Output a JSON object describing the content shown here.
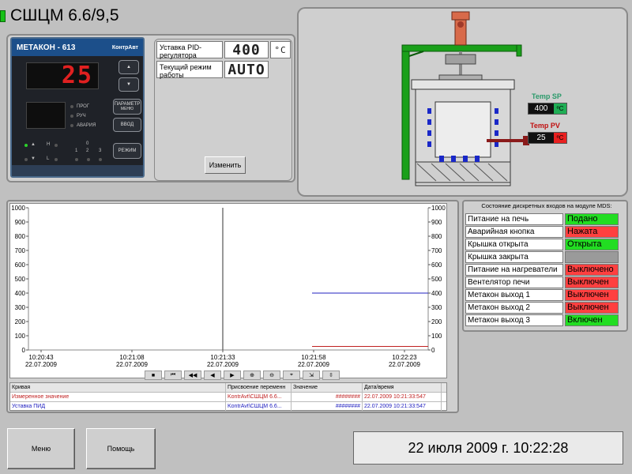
{
  "header": {
    "title": "СШЦМ 6.6/9,5"
  },
  "device": {
    "name": "МЕТАКОН - 613",
    "brand": "КонтрАвт",
    "display_value": "25",
    "indicators": [
      "ПРОГ",
      "РУЧ",
      "АВАРИЯ"
    ],
    "param_button": "ПАРАМЕТР",
    "menu_sub": "МЕНЮ",
    "enter_button": "ВВОД",
    "mode_button": "РЕЖИМ",
    "bank_labels": [
      "0",
      "1",
      "2",
      "3"
    ],
    "h_label": "H",
    "l_label": "L"
  },
  "setpoint": {
    "sp_label": "Уставка PID-регулятора",
    "sp_value": "400",
    "sp_unit": "°C",
    "mode_label": "Текущий режим работы",
    "mode_value": "AUTO",
    "change_button": "Изменить"
  },
  "furnace": {
    "temp_sp_label": "Temp SP",
    "temp_sp_value": "400",
    "temp_sp_unit": "ºC",
    "temp_pv_label": "Temp PV",
    "temp_pv_value": "25",
    "temp_pv_unit": "ºC"
  },
  "discrete": {
    "title": "Состояние дискретных входов на модуле MDS:",
    "rows": [
      {
        "name": "Питание на печь",
        "value": "Подано",
        "color": "#22dd22"
      },
      {
        "name": "Аварийная кнопка",
        "value": "Нажата",
        "color": "#ff4040"
      },
      {
        "name": "Крышка открыта",
        "value": "Открыта",
        "color": "#22dd22"
      },
      {
        "name": "Крышка закрыта",
        "value": "",
        "color": "#9a9a9a"
      },
      {
        "name": "Питание на нагреватели",
        "value": "Выключено",
        "color": "#ff4040"
      },
      {
        "name": "Вентелятор печи",
        "value": "Выключен",
        "color": "#ff4040"
      },
      {
        "name": "Метакон выход 1",
        "value": "Выключен",
        "color": "#ff4040"
      },
      {
        "name": "Метакон выход 2",
        "value": "Выключен",
        "color": "#ff4040"
      },
      {
        "name": "Метакон выход 3",
        "value": "Включен",
        "color": "#22dd22"
      }
    ]
  },
  "chart_data": {
    "type": "line",
    "ylim": [
      0,
      1000
    ],
    "y_ticks": [
      "1000",
      "900",
      "800",
      "700",
      "600",
      "500",
      "400",
      "300",
      "200",
      "100",
      "0"
    ],
    "x_ticks": [
      {
        "time": "10:20:43",
        "date": "22.07.2009"
      },
      {
        "time": "10:21:08",
        "date": "22.07.2009"
      },
      {
        "time": "10:21:33",
        "date": "22.07.2009"
      },
      {
        "time": "10:21:58",
        "date": "22.07.2009"
      },
      {
        "time": "10:22:23",
        "date": "22.07.2009"
      }
    ],
    "series": [
      {
        "name": "Измеренное значение",
        "color": "#c02020",
        "values": [
          25,
          25
        ]
      },
      {
        "name": "Уставка ПИД",
        "color": "#2020c0",
        "values": [
          400,
          400
        ]
      }
    ],
    "cursor_time": "10:21:33"
  },
  "legend": {
    "headers": [
      "Кривая",
      "Присвоение переменн",
      "Значение",
      "Дата/время"
    ],
    "rows": [
      {
        "curve": "Измеренное значение",
        "var": "KontrAvt\\СШЦМ 6.6...",
        "value": "########",
        "datetime": "22.07.2009 10:21:33:547",
        "color": "#c02020"
      },
      {
        "curve": "Уставка ПИД",
        "var": "KontrAvt\\СШЦМ 6.6...",
        "value": "########",
        "datetime": "22.07.2009 10:21:33:547",
        "color": "#2020c0"
      }
    ]
  },
  "footer": {
    "menu_button": "Меню",
    "help_button": "Помощь",
    "datetime": "22 июля 2009 г. 10:22:28"
  }
}
